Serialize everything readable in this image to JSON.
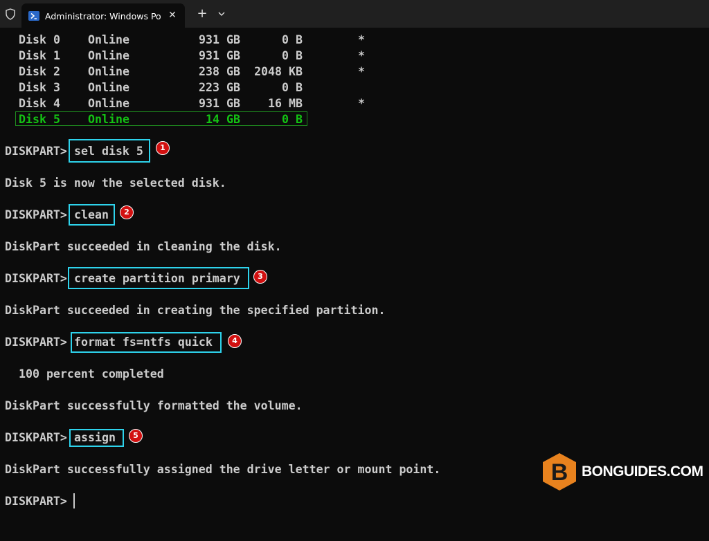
{
  "window": {
    "tab_title": "Administrator: Windows PowerShell",
    "close_glyph": "✕",
    "new_tab_glyph": "+"
  },
  "disk_table": [
    {
      "disk": "Disk 0",
      "status": "Online",
      "size": "931 GB",
      "free": "0 B",
      "gpt": "*",
      "selected": false
    },
    {
      "disk": "Disk 1",
      "status": "Online",
      "size": "931 GB",
      "free": "0 B",
      "gpt": "*",
      "selected": false
    },
    {
      "disk": "Disk 2",
      "status": "Online",
      "size": "238 GB",
      "free": "2048 KB",
      "gpt": "*",
      "selected": false
    },
    {
      "disk": "Disk 3",
      "status": "Online",
      "size": "223 GB",
      "free": "0 B",
      "gpt": "",
      "selected": false
    },
    {
      "disk": "Disk 4",
      "status": "Online",
      "size": "931 GB",
      "free": "16 MB",
      "gpt": "*",
      "selected": false
    },
    {
      "disk": "Disk 5",
      "status": "Online",
      "size": "14 GB",
      "free": "0 B",
      "gpt": "",
      "selected": true
    }
  ],
  "session": {
    "prompt": "DISKPART>",
    "steps": [
      {
        "command": "sel disk 5",
        "badge": "1",
        "output": "Disk 5 is now the selected disk."
      },
      {
        "command": "clean",
        "badge": "2",
        "output": "DiskPart succeeded in cleaning the disk."
      },
      {
        "command": "create partition primary",
        "badge": "3",
        "output": "DiskPart succeeded in creating the specified partition."
      },
      {
        "command": "format fs=ntfs quick",
        "badge": "4",
        "progress": "  100 percent completed",
        "output": "DiskPart successfully formatted the volume."
      },
      {
        "command": "assign",
        "badge": "5",
        "output": "DiskPart successfully assigned the drive letter or mount point."
      }
    ]
  },
  "watermark": {
    "logo_letter": "B",
    "text": "BONGUIDES.COM",
    "logo_color": "#e8821e"
  },
  "colors": {
    "background": "#0c0c0c",
    "text": "#cccccc",
    "selected_disk": "#13c213",
    "command_highlight": "#2ed3ec",
    "badge": "#d21010"
  }
}
